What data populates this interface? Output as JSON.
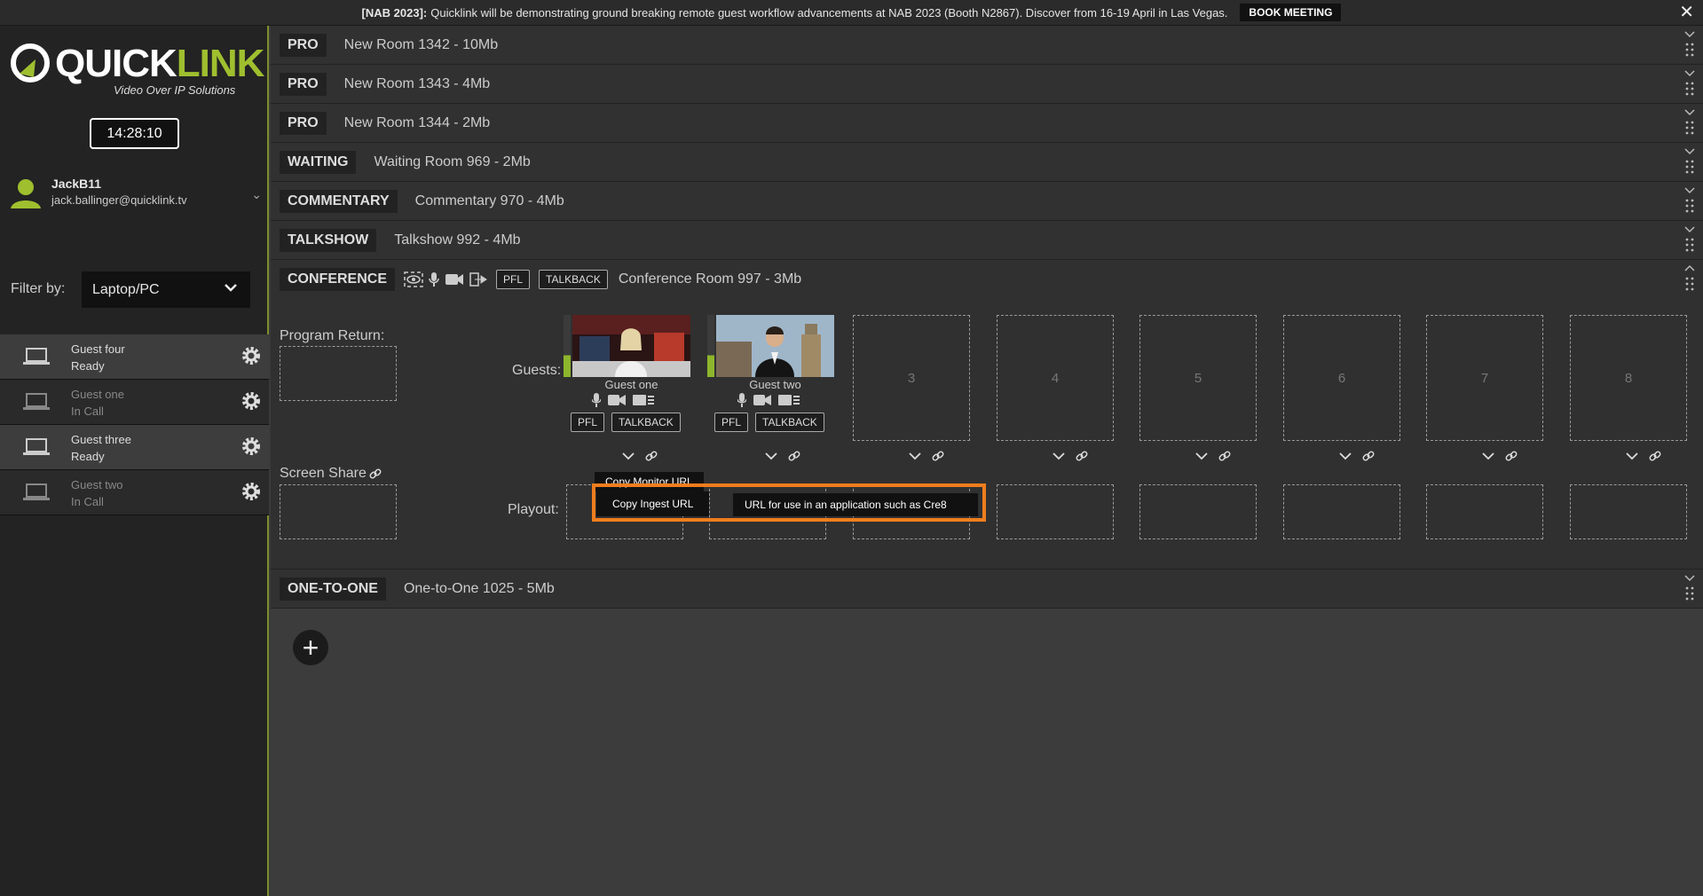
{
  "banner": {
    "tag": "[NAB 2023]:",
    "text": "Quicklink will be demonstrating ground breaking remote guest workflow advancements at NAB 2023 (Booth N2867). Discover from 16-19 April in Las Vegas.",
    "button": "BOOK MEETING",
    "close": "✕"
  },
  "sidebar": {
    "logo_word_a": "QUICK",
    "logo_word_b": "LINK",
    "logo_tagline": "Video Over IP Solutions",
    "clock": "14:28:10",
    "user": {
      "name": "JackB11",
      "email": "jack.ballinger@quicklink.tv"
    },
    "filter_label": "Filter by:",
    "filter_value": "Laptop/PC",
    "guests": [
      {
        "name": "Guest four",
        "status": "Ready"
      },
      {
        "name": "Guest one",
        "status": "In Call"
      },
      {
        "name": "Guest three",
        "status": "Ready"
      },
      {
        "name": "Guest two",
        "status": "In Call"
      }
    ]
  },
  "rooms_top": [
    {
      "type": "PRO",
      "name": "New Room 1342 - 10Mb"
    },
    {
      "type": "PRO",
      "name": "New Room 1343 - 4Mb"
    },
    {
      "type": "PRO",
      "name": "New Room 1344 - 2Mb"
    },
    {
      "type": "WAITING",
      "name": "Waiting Room 969 - 2Mb"
    },
    {
      "type": "COMMENTARY",
      "name": "Commentary 970 - 4Mb"
    },
    {
      "type": "TALKSHOW",
      "name": "Talkshow 992 - 4Mb"
    }
  ],
  "conference": {
    "type": "CONFERENCE",
    "pfl": "PFL",
    "talkback": "TALKBACK",
    "name": "Conference Room 997 - 3Mb",
    "program_return": "Program Return:",
    "guests_label": "Guests:",
    "screen_share": "Screen Share",
    "playout": "Playout:",
    "guests": [
      {
        "name": "Guest one",
        "pfl": "PFL",
        "talkback": "TALKBACK"
      },
      {
        "name": "Guest two",
        "pfl": "PFL",
        "talkback": "TALKBACK"
      }
    ],
    "empty_slots": [
      "3",
      "4",
      "5",
      "6",
      "7",
      "8"
    ],
    "menu": {
      "copy_monitor": "Copy Monitor URL",
      "copy_ingest": "Copy Ingest URL",
      "hint": "URL for use in an application such as Cre8"
    }
  },
  "room_bottom": {
    "type": "ONE-TO-ONE",
    "name": "One-to-One 1025 - 5Mb"
  },
  "add_button": "+",
  "colors": {
    "accent": "#9fbf2f",
    "highlight": "#f07d1d"
  }
}
